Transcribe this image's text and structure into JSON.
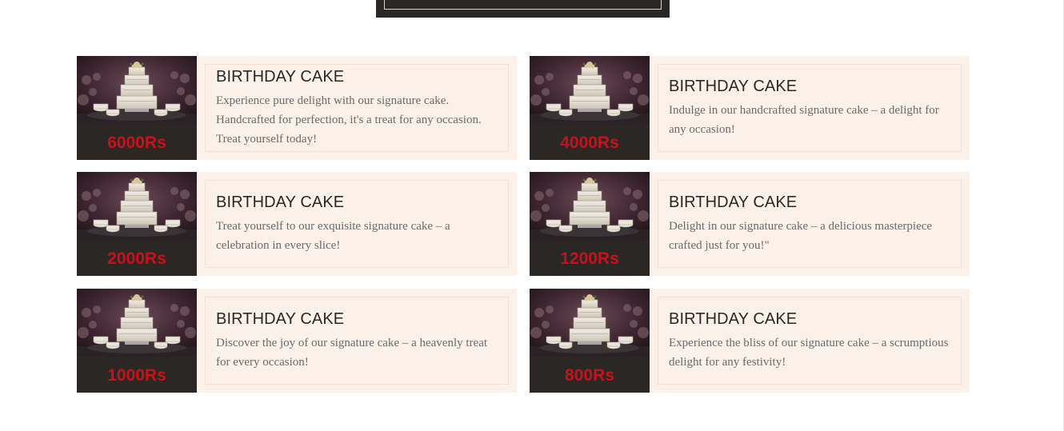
{
  "products": [
    {
      "title": "BIRTHDAY CAKE",
      "price": "6000Rs",
      "description": "Experience pure delight with our signature cake. Handcrafted for perfection, it's a treat for any occasion. Treat yourself today!"
    },
    {
      "title": "BIRTHDAY CAKE",
      "price": "4000Rs",
      "description": "Indulge in our handcrafted signature cake – a delight for any occasion!"
    },
    {
      "title": "BIRTHDAY CAKE",
      "price": "2000Rs",
      "description": "Treat yourself to our exquisite signature cake – a celebration in every slice!"
    },
    {
      "title": "BIRTHDAY CAKE",
      "price": "1200Rs",
      "description": "Delight in our signature cake – a delicious masterpiece crafted just for you!\""
    },
    {
      "title": "BIRTHDAY CAKE",
      "price": "1000Rs",
      "description": "Discover the joy of our signature cake – a heavenly treat for every occasion!"
    },
    {
      "title": "BIRTHDAY CAKE",
      "price": "800Rs",
      "description": "Experience the bliss of our signature cake – a scrumptious delight for any festivity!"
    }
  ],
  "colors": {
    "price": "#c8121b",
    "card_bg": "#fcf1e8",
    "dark": "#2b2725"
  }
}
